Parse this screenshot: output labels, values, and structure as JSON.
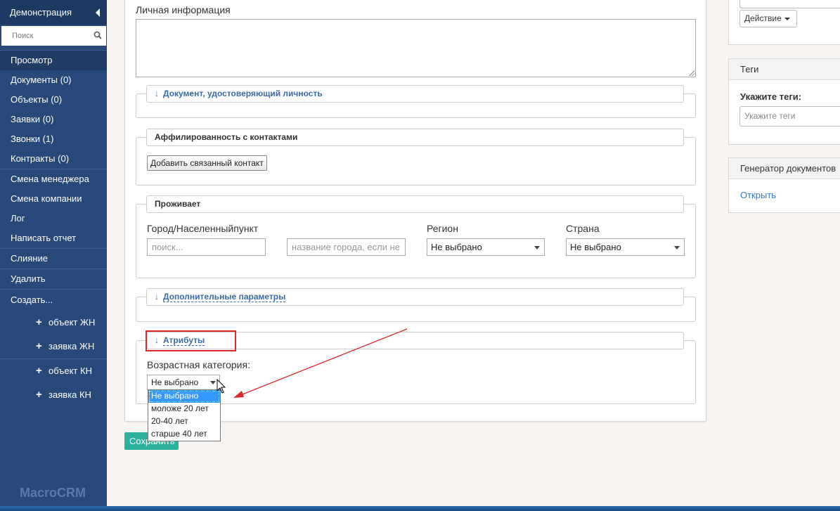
{
  "sidebar": {
    "title": "Демонстрация",
    "search_placeholder": "Поиск",
    "items": [
      {
        "label": "Просмотр"
      },
      {
        "label": "Документы (0)"
      },
      {
        "label": "Объекты (0)"
      },
      {
        "label": "Заявки (0)"
      },
      {
        "label": "Звонки (1)"
      },
      {
        "label": "Контракты (0)"
      },
      {
        "label": "Смена менеджера"
      },
      {
        "label": "Смена компании"
      },
      {
        "label": "Лог"
      },
      {
        "label": "Написать отчет"
      },
      {
        "label": "Слияние"
      },
      {
        "label": "Удалить"
      },
      {
        "label": "Создать..."
      }
    ],
    "create_items": [
      {
        "label": "объект ЖН"
      },
      {
        "label": "заявка ЖН"
      },
      {
        "label": "объект КН"
      },
      {
        "label": "заявка КН"
      }
    ],
    "brand": "MacroCRM"
  },
  "form": {
    "personal_info_label": "Личная информация",
    "identity_doc_legend": "Документ, удостоверяющий личность",
    "affiliation_legend": "Аффилированность с контактами",
    "add_contact_button": "Добавить связанный контакт",
    "residence_legend": "Проживает",
    "city_label": "Город/Населенныйпункт",
    "city_search_placeholder": "поиск...",
    "city_name_placeholder": "название города, если не",
    "region_label": "Регион",
    "region_value": "Не выбрано",
    "country_label": "Страна",
    "country_value": "Не выбрано",
    "extra_params_legend": "Дополнительные параметры",
    "attributes_legend": "Атрибуты",
    "age_category_label": "Возрастная категория:",
    "age_category_value": "Не выбрано",
    "age_options": [
      "Не выбрано",
      "моложе 20 лет",
      "20-40 лет",
      "старше 40 лет"
    ],
    "save_button": "Сохранить"
  },
  "right": {
    "action_button": "Действие",
    "tags_title": "Теги",
    "tags_label": "Укажите теги:",
    "tags_placeholder": "Укажите теги",
    "docgen_title": "Генератор документов",
    "open_link": "Открыть"
  },
  "colors": {
    "sidebar_bg": "#27497a",
    "link": "#3a6aa8",
    "annotation": "#e0262b",
    "save_button": "#2bb19e"
  }
}
